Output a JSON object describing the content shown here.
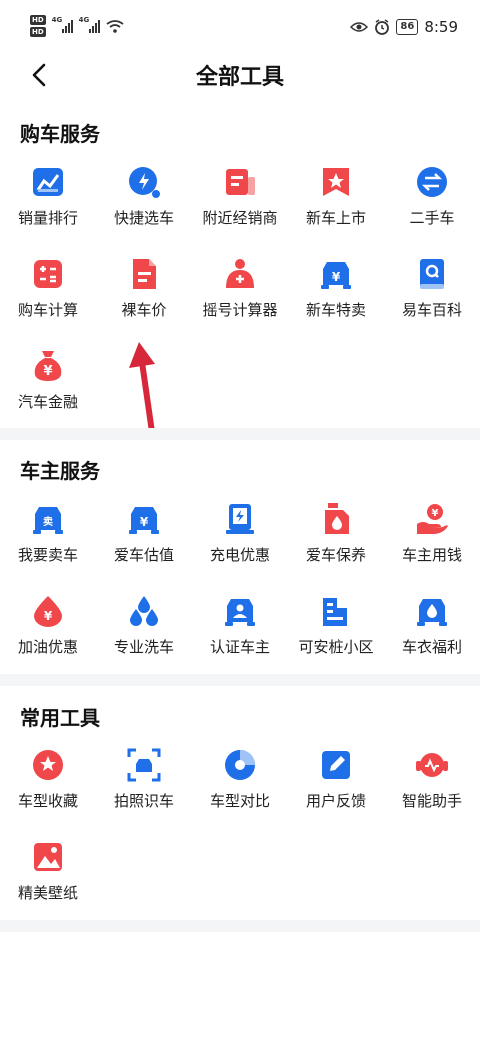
{
  "status_bar": {
    "hd1": "HD",
    "hd2": "HD",
    "net1": "4G",
    "net2": "4G",
    "battery": "86",
    "time": "8:59"
  },
  "header": {
    "title": "全部工具"
  },
  "sections": [
    {
      "title": "购车服务",
      "items": [
        {
          "label": "销量排行",
          "icon": "sales-ranking-icon"
        },
        {
          "label": "快捷选车",
          "icon": "quick-select-icon"
        },
        {
          "label": "附近经销商",
          "icon": "dealer-icon"
        },
        {
          "label": "新车上市",
          "icon": "new-car-icon"
        },
        {
          "label": "二手车",
          "icon": "used-car-icon"
        },
        {
          "label": "购车计算",
          "icon": "calculator-icon"
        },
        {
          "label": "裸车价",
          "icon": "price-doc-icon"
        },
        {
          "label": "摇号计算器",
          "icon": "lottery-icon"
        },
        {
          "label": "新车特卖",
          "icon": "special-sale-icon"
        },
        {
          "label": "易车百科",
          "icon": "encyclopedia-icon"
        },
        {
          "label": "汽车金融",
          "icon": "money-bag-icon"
        }
      ]
    },
    {
      "title": "车主服务",
      "items": [
        {
          "label": "我要卖车",
          "icon": "sell-car-icon"
        },
        {
          "label": "爱车估值",
          "icon": "valuation-icon"
        },
        {
          "label": "充电优惠",
          "icon": "charging-icon"
        },
        {
          "label": "爱车保养",
          "icon": "oil-icon"
        },
        {
          "label": "车主用钱",
          "icon": "hand-coin-icon"
        },
        {
          "label": "加油优惠",
          "icon": "fuel-icon"
        },
        {
          "label": "专业洗车",
          "icon": "water-drops-icon"
        },
        {
          "label": "认证车主",
          "icon": "verified-owner-icon"
        },
        {
          "label": "可安桩小区",
          "icon": "building-icon"
        },
        {
          "label": "车衣福利",
          "icon": "car-cover-icon"
        }
      ]
    },
    {
      "title": "常用工具",
      "items": [
        {
          "label": "车型收藏",
          "icon": "favorite-icon"
        },
        {
          "label": "拍照识车",
          "icon": "scan-car-icon"
        },
        {
          "label": "车型对比",
          "icon": "pie-compare-icon"
        },
        {
          "label": "用户反馈",
          "icon": "edit-feedback-icon"
        },
        {
          "label": "智能助手",
          "icon": "assistant-icon"
        },
        {
          "label": "精美壁纸",
          "icon": "wallpaper-icon"
        }
      ]
    }
  ],
  "colors": {
    "blue": "#1E6FE8",
    "red": "#F0474A",
    "divider": "#F4F5F7",
    "annotation": "#D6283A"
  }
}
